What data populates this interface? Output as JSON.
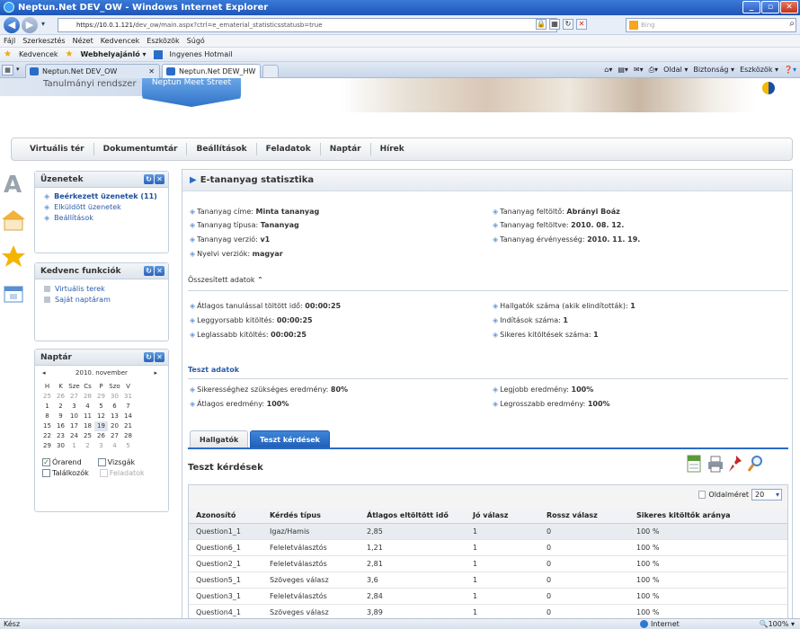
{
  "browser": {
    "window_title": "Neptun.Net DEV_OW - Windows Internet Explorer",
    "url_host": "https://10.0.1.121/",
    "url_path": "dev_ow/main.aspx?ctrl=e_ematerial_statisticsstatusb=true",
    "search_placeholder": "Bing",
    "menu": [
      "Fájl",
      "Szerkesztés",
      "Nézet",
      "Kedvencek",
      "Eszközök",
      "Súgó"
    ],
    "favorites_label": "Kedvencek",
    "favorites_items": [
      "Webhelyajánló ▾",
      "Ingyenes Hotmail"
    ],
    "tabs": [
      {
        "label": "Neptun.Net DEV_OW",
        "active": false
      },
      {
        "label": "Neptun.Net DEW_HW",
        "active": true
      }
    ],
    "cmd_items": [
      "Oldal ▾",
      "Biztonság ▾",
      "Eszközök ▾"
    ],
    "status_left": "Kész",
    "status_zone": "Internet",
    "status_zoom": "100%"
  },
  "site": {
    "system_name": "Tanulmányi rendszer",
    "banner_button": "Neptun Meet Street",
    "nav": [
      "Virtuális tér",
      "Dokumentumtár",
      "Beállítások",
      "Feladatok",
      "Naptár",
      "Hírek"
    ]
  },
  "messages_box": {
    "title": "Üzenetek",
    "links": [
      "Beérkezett üzenetek (11)",
      "Elküldött üzenetek",
      "Beállítások"
    ]
  },
  "favorites_box": {
    "title": "Kedvenc funkciók",
    "links": [
      "Virtuális terek",
      "Saját naptáram"
    ]
  },
  "calendar_box": {
    "title": "Naptár",
    "month": "2010. november",
    "weekdays": [
      "H",
      "K",
      "Sze",
      "Cs",
      "P",
      "Szo",
      "V"
    ],
    "weeks": [
      [
        "25",
        "26",
        "27",
        "28",
        "29",
        "30",
        "31"
      ],
      [
        "1",
        "2",
        "3",
        "4",
        "5",
        "6",
        "7"
      ],
      [
        "8",
        "9",
        "10",
        "11",
        "12",
        "13",
        "14"
      ],
      [
        "15",
        "16",
        "17",
        "18",
        "19",
        "20",
        "21"
      ],
      [
        "22",
        "23",
        "24",
        "25",
        "26",
        "27",
        "28"
      ],
      [
        "29",
        "30",
        "1",
        "2",
        "3",
        "4",
        "5"
      ]
    ],
    "checks": [
      {
        "label": "Órarend",
        "checked": true
      },
      {
        "label": "Vizsgák",
        "checked": false
      },
      {
        "label": "Találkozók",
        "checked": false
      },
      {
        "label": "Feladatok",
        "checked": false
      }
    ]
  },
  "content": {
    "title": "E-tananyag statisztika",
    "info_left": [
      {
        "label": "Tananyag címe:",
        "value": "Minta tananyag"
      },
      {
        "label": "Tananyag típusa:",
        "value": "Tananyag"
      },
      {
        "label": "Tananyag verzió:",
        "value": "v1"
      },
      {
        "label": "Nyelvi verziók:",
        "value": "magyar"
      }
    ],
    "info_right": [
      {
        "label": "Tananyag feltöltő:",
        "value": "Abrányi Boáz"
      },
      {
        "label": "Tananyag feltöltve:",
        "value": "2010. 08. 12."
      },
      {
        "label": "Tananyag érvényesség:",
        "value": "2010. 11. 19."
      }
    ],
    "summary_title": "Összesített adatok",
    "summary_left": [
      {
        "label": "Átlagos tanulással töltött idő:",
        "value": "00:00:25"
      },
      {
        "label": "Leggyorsabb kitöltés:",
        "value": "00:00:25"
      },
      {
        "label": "Leglassabb kitöltés:",
        "value": "00:00:25"
      }
    ],
    "summary_right": [
      {
        "label": "Hallgatók száma (akik elindították):",
        "value": "1"
      },
      {
        "label": "Indítások száma:",
        "value": "1"
      },
      {
        "label": "Sikeres kitöltések száma:",
        "value": "1"
      }
    ],
    "test_title": "Teszt adatok",
    "test_left": [
      {
        "label": "Sikerességhez szükséges eredmény:",
        "value": "80%"
      },
      {
        "label": "Átlagos eredmény:",
        "value": "100%"
      }
    ],
    "test_right": [
      {
        "label": "Legjobb eredmény:",
        "value": "100%"
      },
      {
        "label": "Legrosszabb eredmény:",
        "value": "100%"
      }
    ],
    "tabs": [
      {
        "label": "Hallgatók",
        "active": false
      },
      {
        "label": "Teszt kérdések",
        "active": true
      }
    ],
    "questions_title": "Teszt kérdések",
    "page_size_label": "Oldalméret",
    "page_size_value": "20",
    "columns": [
      "Azonosító",
      "Kérdés típus",
      "Átlagos eltöltött idő",
      "Jó válasz",
      "Rossz válasz",
      "Sikeres kitöltők aránya"
    ],
    "rows": [
      [
        "Question1_1",
        "Igaz/Hamis",
        "2,85",
        "1",
        "0",
        "100 %"
      ],
      [
        "Question6_1",
        "Feleletválasztós",
        "1,21",
        "1",
        "0",
        "100 %"
      ],
      [
        "Question2_1",
        "Feleletválasztós",
        "2,81",
        "1",
        "0",
        "100 %"
      ],
      [
        "Question5_1",
        "Szöveges válasz",
        "3,6",
        "1",
        "0",
        "100 %"
      ],
      [
        "Question3_1",
        "Feleletválasztós",
        "2,84",
        "1",
        "0",
        "100 %"
      ],
      [
        "Question4_1",
        "Szöveges válasz",
        "3,89",
        "1",
        "0",
        "100 %"
      ]
    ]
  }
}
